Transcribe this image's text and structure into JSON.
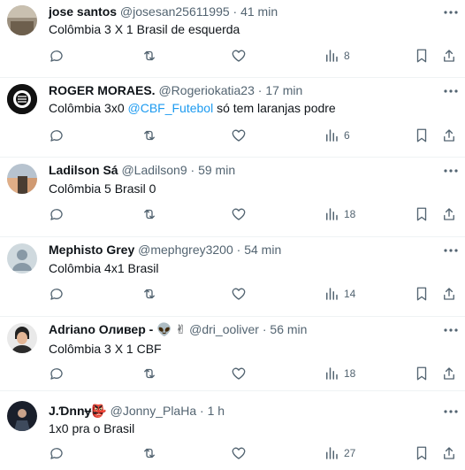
{
  "icons": {
    "more": "more-horizontal-icon",
    "reply": "reply-icon",
    "retweet": "retweet-icon",
    "like": "heart-icon",
    "views": "views-chart-icon",
    "bookmark": "bookmark-icon",
    "share": "share-icon"
  },
  "colors": {
    "mention": "#1d9bf0",
    "muted": "#536471",
    "separator": "#eff3f4"
  },
  "tweets": [
    {
      "name": "jose santos",
      "handle": "@josesan25611995",
      "dot": "·",
      "time": "41 min",
      "text": "Colômbia 3 X 1 Brasil de esquerda",
      "views": "8"
    },
    {
      "name": "ROGER MORAES.",
      "handle": "@Rogeriokatia23",
      "dot": "·",
      "time": "17 min",
      "text_pre": "Colômbia 3x0 ",
      "mention": "@CBF_Futebol",
      "text_post": " só tem laranjas podre",
      "views": "6"
    },
    {
      "name": "Ladilson Sá",
      "handle": "@Ladilson9",
      "dot": "·",
      "time": "59 min",
      "text": "Colômbia 5 Brasil 0",
      "views": "18"
    },
    {
      "name": "Mephisto Grey",
      "handle": "@mephgrey3200",
      "dot": "·",
      "time": "54 min",
      "text": "Colômbia 4x1 Brasil",
      "views": "14"
    },
    {
      "name": "Adriano Оливер -",
      "name_emoji": "👽 ✌",
      "handle": "@dri_ooliver",
      "dot": "·",
      "time": "56 min",
      "text": "Colômbia 3 X 1 CBF",
      "views": "18"
    },
    {
      "name": "J.Ɗnnɏ",
      "name_emoji": "👺",
      "handle": "@Jonny_PlaHa",
      "dot": "·",
      "time": "1 h",
      "text": "1x0 pra o Brasil",
      "views": "27"
    }
  ]
}
